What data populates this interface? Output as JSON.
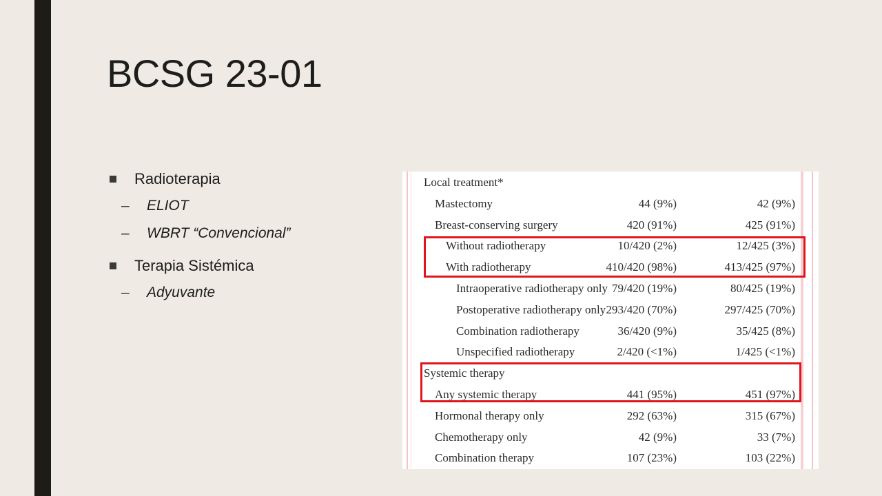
{
  "slide": {
    "title": "BCSG 23-01",
    "bullets": [
      {
        "label": "Radioterapia",
        "children": [
          "ELIOT",
          "WBRT “Convencional”"
        ]
      },
      {
        "label": "Terapia Sistémica",
        "children": [
          "Adyuvante"
        ]
      }
    ]
  },
  "table": {
    "rows": [
      {
        "label": "Local treatment*",
        "indent": 0,
        "col1": "",
        "col2": ""
      },
      {
        "label": "Mastectomy",
        "indent": 1,
        "col1": "44 (9%)",
        "col2": "42 (9%)"
      },
      {
        "label": "Breast-conserving surgery",
        "indent": 1,
        "col1": "420 (91%)",
        "col2": "425 (91%)"
      },
      {
        "label": "Without radiotherapy",
        "indent": 2,
        "col1": "10/420 (2%)",
        "col2": "12/425 (3%)"
      },
      {
        "label": "With radiotherapy",
        "indent": 2,
        "col1": "410/420 (98%)",
        "col2": "413/425 (97%)"
      },
      {
        "label": "Intraoperative radiotherapy only",
        "indent": 3,
        "col1": "79/420 (19%)",
        "col2": "80/425 (19%)"
      },
      {
        "label": "Postoperative radiotherapy only",
        "indent": 3,
        "col1": "293/420 (70%)",
        "col2": "297/425 (70%)"
      },
      {
        "label": "Combination radiotherapy",
        "indent": 3,
        "col1": "36/420 (9%)",
        "col2": "35/425 (8%)"
      },
      {
        "label": "Unspecified radiotherapy",
        "indent": 3,
        "col1": "2/420 (<1%)",
        "col2": "1/425 (<1%)"
      },
      {
        "label": "Systemic therapy",
        "indent": 0,
        "col1": "",
        "col2": ""
      },
      {
        "label": "Any systemic therapy",
        "indent": 1,
        "col1": "441 (95%)",
        "col2": "451 (97%)"
      },
      {
        "label": "Hormonal therapy only",
        "indent": 1,
        "col1": "292 (63%)",
        "col2": "315 (67%)"
      },
      {
        "label": "Chemotherapy only",
        "indent": 1,
        "col1": "42 (9%)",
        "col2": "33 (7%)"
      },
      {
        "label": "Combination therapy",
        "indent": 1,
        "col1": "107 (23%)",
        "col2": "103 (22%)"
      }
    ],
    "highlight_color": "#e0161d"
  },
  "colors": {
    "background": "#efebe4",
    "accent_bar": "#1d1c17"
  }
}
